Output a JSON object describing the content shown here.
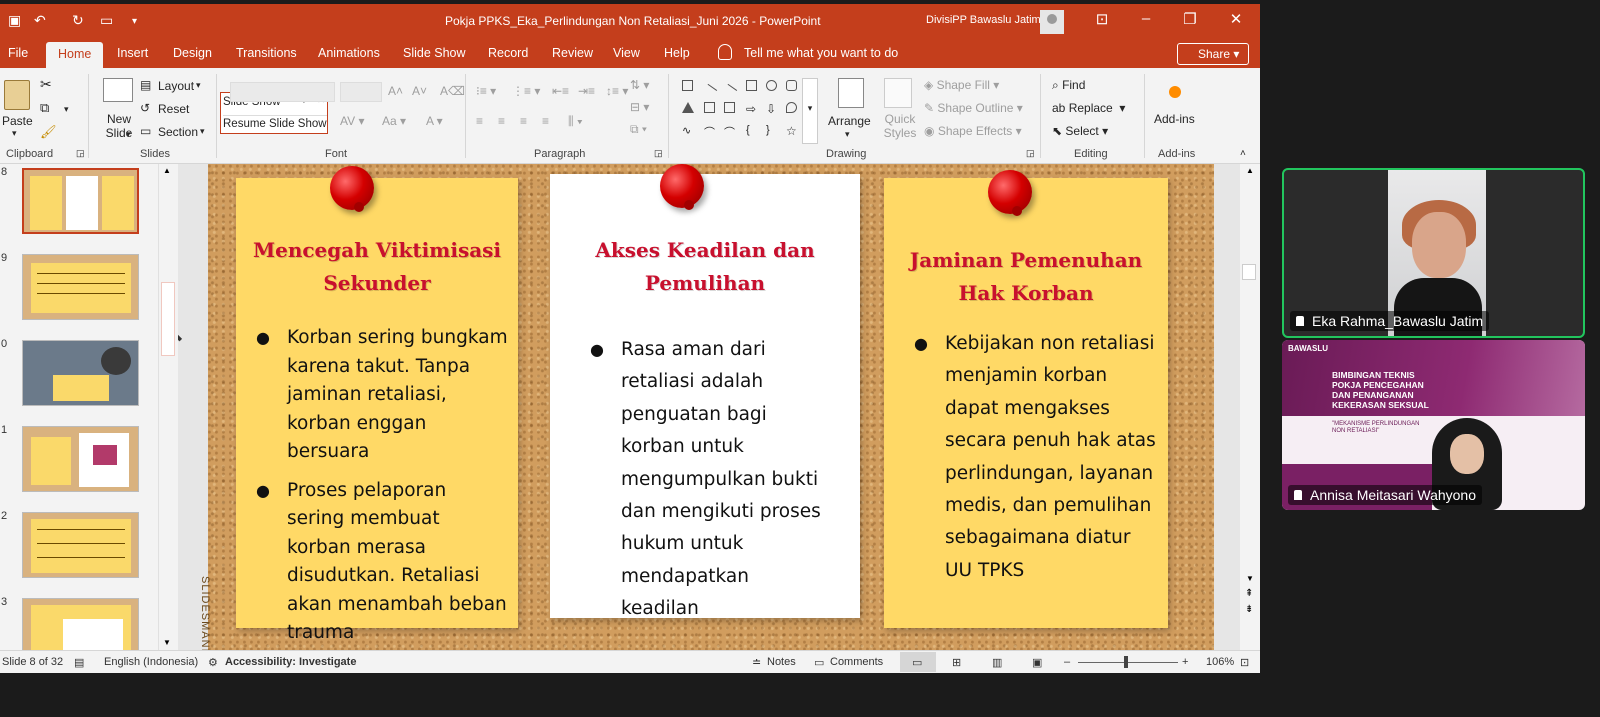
{
  "window": {
    "title": "Pokja PPKS_Eka_Perlindungan Non Retaliasi_Juni 2026  -  PowerPoint",
    "user": "DivisiPP Bawaslu Jatim"
  },
  "tabs": [
    "File",
    "Home",
    "Insert",
    "Design",
    "Transitions",
    "Animations",
    "Slide Show",
    "Record",
    "Review",
    "View",
    "Help"
  ],
  "tell_me": "Tell me what you want to do",
  "share": "Share",
  "ribbon": {
    "paste": "Paste",
    "new_slide": "New Slide",
    "layout": "Layout",
    "reset": "Reset",
    "section": "Section",
    "slideshow_field": "Slide Show",
    "resume_slideshow": "Resume Slide Show",
    "arrange": "Arrange",
    "quick_styles": "Quick Styles",
    "shape_fill": "Shape Fill",
    "shape_outline": "Shape Outline",
    "shape_effects": "Shape Effects",
    "find": "Find",
    "replace": "Replace",
    "select": "Select",
    "addins": "Add-ins",
    "groups": {
      "clipboard": "Clipboard",
      "slides": "Slides",
      "font": "Font",
      "paragraph": "Paragraph",
      "drawing": "Drawing",
      "editing": "Editing",
      "addins": "Add-ins"
    }
  },
  "thumbnails": {
    "numbers": [
      "8",
      "9",
      "0",
      "1",
      "2",
      "3"
    ]
  },
  "slide": {
    "cards": [
      {
        "title": "Mencegah Viktimisasi Sekunder",
        "bullets": [
          "Korban sering bungkam karena takut. Tanpa jaminan retaliasi, korban enggan bersuara",
          "Proses pelaporan sering membuat korban merasa disudutkan. Retaliasi akan menambah beban trauma"
        ]
      },
      {
        "title": "Akses Keadilan dan Pemulihan",
        "bullets": [
          "Rasa aman dari retaliasi adalah penguatan bagi korban untuk mengumpulkan bukti dan mengikuti proses hukum untuk mendapatkan keadilan"
        ]
      },
      {
        "title": "Jaminan Pemenuhan Hak Korban",
        "bullets": [
          "Kebijakan non retaliasi menjamin korban dapat mengakses secara penuh hak atas perlindungan, layanan medis, dan pemulihan sebagaimana diatur UU TPKS"
        ]
      }
    ],
    "watermark": "SLIDESMANI"
  },
  "status": {
    "slide": "Slide 8 of 32",
    "language": "English (Indonesia)",
    "accessibility": "Accessibility: Investigate",
    "notes": "Notes",
    "comments": "Comments",
    "zoom": "106%"
  },
  "meeting": {
    "participant1": "Eka Rahma_Bawaslu Jatim",
    "participant2": "Annisa Meitasari Wahyono",
    "banner_logo": "BAWASLU",
    "banner_title": "BIMBINGAN TEKNIS POKJA PENCEGAHAN DAN PENANGANAN KEKERASAN SEKSUAL",
    "banner_sub": "\"MEKANISME PERLINDUNGAN NON RETALIASI\""
  },
  "colors": {
    "accent": "#c43e1c",
    "card_yellow": "#ffd966",
    "title_red": "#c8102e",
    "active_speaker": "#22c55e"
  }
}
